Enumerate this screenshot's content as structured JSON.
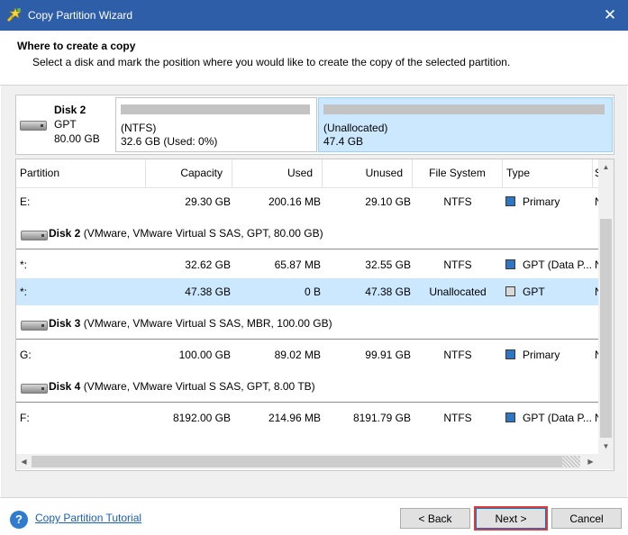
{
  "window": {
    "title": "Copy Partition Wizard",
    "close_glyph": "✕"
  },
  "header": {
    "title": "Where to create a copy",
    "subtitle": "Select a disk and mark the position where you would like to create the copy of the selected partition."
  },
  "disk_map": {
    "name": "Disk 2",
    "type": "GPT",
    "size": "80.00 GB",
    "blocks": [
      {
        "fs": "(NTFS)",
        "info": "32.6 GB (Used: 0%)"
      },
      {
        "fs": "(Unallocated)",
        "info": "47.4 GB"
      }
    ]
  },
  "table": {
    "columns": [
      "Partition",
      "Capacity",
      "Used",
      "Unused",
      "File System",
      "Type",
      "S"
    ],
    "rows": {
      "e": {
        "partition": "E:",
        "capacity": "29.30 GB",
        "used": "200.16 MB",
        "unused": "29.10 GB",
        "fs": "NTFS",
        "type": "Primary",
        "s": "N"
      },
      "disk2": {
        "name": "Disk 2",
        "desc": " (VMware, VMware Virtual S SAS, GPT, 80.00 GB)"
      },
      "p1": {
        "partition": "*:",
        "capacity": "32.62 GB",
        "used": "65.87 MB",
        "unused": "32.55 GB",
        "fs": "NTFS",
        "type": "GPT (Data P...",
        "s": "N"
      },
      "p2": {
        "partition": "*:",
        "capacity": "47.38 GB",
        "used": "0 B",
        "unused": "47.38 GB",
        "fs": "Unallocated",
        "type": "GPT",
        "s": "N"
      },
      "disk3": {
        "name": "Disk 3",
        "desc": " (VMware, VMware Virtual S SAS, MBR, 100.00 GB)"
      },
      "g": {
        "partition": "G:",
        "capacity": "100.00 GB",
        "used": "89.02 MB",
        "unused": "99.91 GB",
        "fs": "NTFS",
        "type": "Primary",
        "s": "N"
      },
      "disk4": {
        "name": "Disk 4",
        "desc": " (VMware, VMware Virtual S SAS, GPT, 8.00 TB)"
      },
      "f": {
        "partition": "F:",
        "capacity": "8192.00 GB",
        "used": "214.96 MB",
        "unused": "8191.79 GB",
        "fs": "NTFS",
        "type": "GPT (Data P...",
        "s": "N"
      }
    }
  },
  "footer": {
    "help_link": "Copy Partition Tutorial",
    "back": "< Back",
    "next": "Next >",
    "cancel": "Cancel"
  },
  "colors": {
    "titlebar": "#2f5ea8",
    "selection": "#cce8ff",
    "primary_box": "#2e75c2",
    "unallocated_box": "#d9d9d9",
    "next_highlight": "#e03b3b"
  }
}
